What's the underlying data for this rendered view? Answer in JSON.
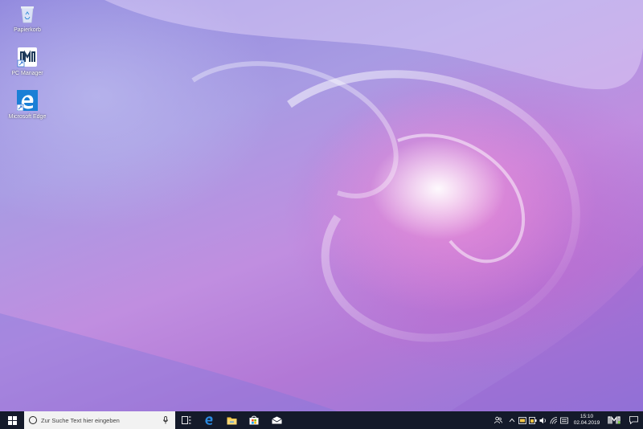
{
  "desktop": {
    "icons": [
      {
        "label": "Papierkorb",
        "icon": "recycle-bin-icon"
      },
      {
        "label": "PC Manager",
        "icon": "pc-manager-icon"
      },
      {
        "label": "Microsoft Edge",
        "icon": "edge-icon"
      }
    ]
  },
  "taskbar": {
    "search_placeholder": "Zur Suche Text hier eingeben",
    "pinned": [
      "task-view-icon",
      "edge-icon",
      "file-explorer-icon",
      "store-icon",
      "mail-icon"
    ],
    "tray_icons": [
      "people-icon",
      "chevron-up-icon",
      "meeting-icon",
      "battery-icon",
      "volume-icon",
      "wifi-icon",
      "input-icon"
    ],
    "clock": {
      "time": "15:10",
      "date": "02.04.2019"
    }
  },
  "colors": {
    "taskbar_bg": "#141a2a",
    "accent": "#0078d7"
  }
}
